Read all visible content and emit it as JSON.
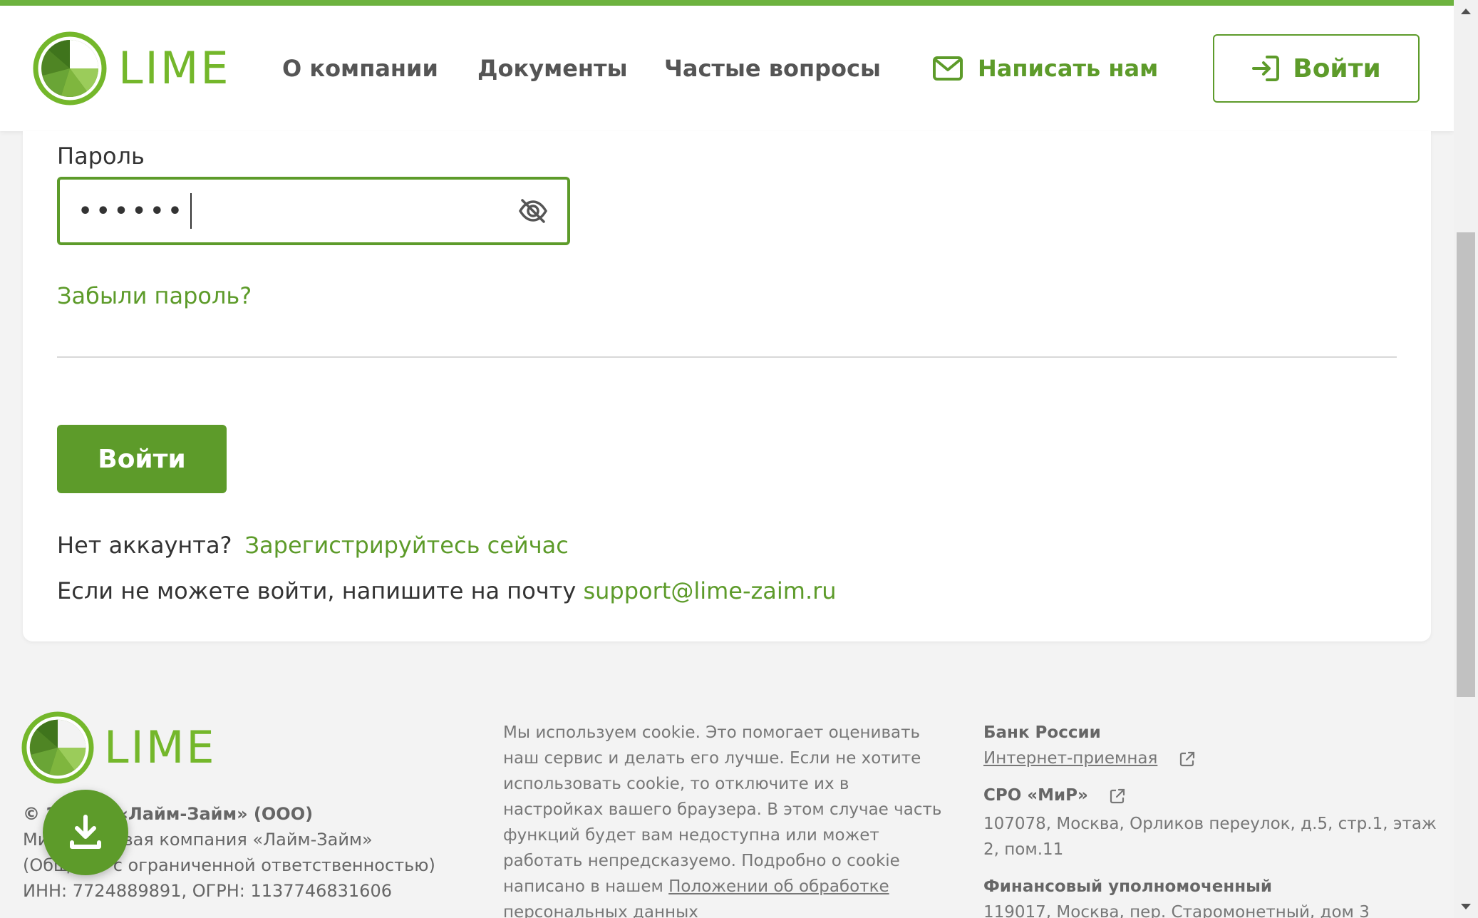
{
  "header": {
    "logo_text": "LIME",
    "nav": {
      "about": "О компании",
      "docs": "Документы",
      "faq": "Частые вопросы",
      "write": "Написать нам"
    },
    "login_button": "Войти"
  },
  "form": {
    "password_label": "Пароль",
    "password_value": "••••••",
    "forgot_link": "Забыли пароль?",
    "submit_button": "Войти",
    "no_account_text": "Нет аккаунта?",
    "register_link": "Зарегистрируйтесь сейчас",
    "support_text": "Если не можете войти, напишите на почту",
    "support_email": "support@lime-zaim.ru"
  },
  "footer": {
    "logo_text": "LIME",
    "company": {
      "line1_prefix": "© 2",
      "line1_bold": "МФК «Лайм-Займ» (ООО)",
      "line2": "Ми          совая компания «Лайм-Займ»",
      "line3": "(Общ        с ограниченной ответственностью)",
      "line4": "ИНН: 7724889891, ОГРН: 1137746831606"
    },
    "cookie": {
      "text": "Мы используем cookie. Это помогает оценивать наш сервис и делать его лучше. Если не хотите использовать cookie, то отключите их в настройках вашего браузера. В этом случае часть функций будет вам недоступна или может работать непредсказуемо. Подробно о cookie написано в нашем",
      "link": "Положении об обработке персональных данных"
    },
    "regulators": {
      "bank_title": "Банк России",
      "bank_link": "Интернет-приемная",
      "sro_title": "СРО «МиР»",
      "sro_address": "107078, Москва, Орликов переулок, д.5, стр.1, этаж 2, пом.11",
      "ombudsman_title": "Финансовый уполномоченный",
      "ombudsman_address": "119017, Москва, пер. Старомонетный, дом 3"
    }
  },
  "colors": {
    "brand_green": "#5d9b2a",
    "logo_green": "#74b72b",
    "background": "#f3f3f3"
  },
  "icons": [
    "mail-icon",
    "login-arrow-icon",
    "eye-off-icon",
    "external-link-icon",
    "download-icon"
  ]
}
